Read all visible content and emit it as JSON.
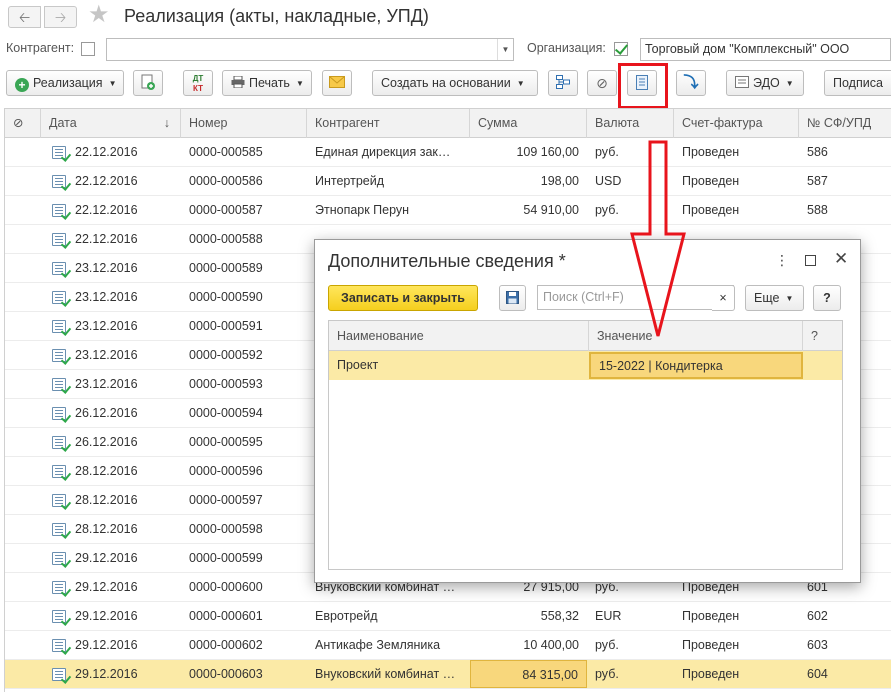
{
  "window": {
    "back_icon": "arrow-left-icon",
    "forward_icon": "arrow-right-icon",
    "star_icon": "star-icon",
    "title": "Реализация (акты, накладные, УПД)"
  },
  "filters": {
    "counterparty_label": "Контрагент:",
    "counterparty_value": "",
    "organization_label": "Организация:",
    "organization_value": "Торговый дом \"Комплексный\" ООО"
  },
  "toolbar": {
    "realization_label": "Реализация",
    "print_label": "Печать",
    "create_based_label": "Создать на основании",
    "edo_label": "ЭДО",
    "sign_label": "Подписа",
    "dtkt_label_top": "ДТ",
    "dtkt_label_bottom": "КТ"
  },
  "table": {
    "columns": [
      "Дата",
      "Номер",
      "Контрагент",
      "Сумма",
      "Валюта",
      "Счет-фактура",
      "№ СФ/УПД"
    ],
    "sort_indicator": "↓",
    "rows": [
      {
        "date": "22.12.2016",
        "number": "0000-000585",
        "counterparty": "Единая дирекция зак…",
        "sum": "109 160,00",
        "currency": "руб.",
        "invoice": "Проведен",
        "sf": "586"
      },
      {
        "date": "22.12.2016",
        "number": "0000-000586",
        "counterparty": "Интертрейд",
        "sum": "198,00",
        "currency": "USD",
        "invoice": "Проведен",
        "sf": "587"
      },
      {
        "date": "22.12.2016",
        "number": "0000-000587",
        "counterparty": "Этнопарк Перун",
        "sum": "54 910,00",
        "currency": "руб.",
        "invoice": "Проведен",
        "sf": "588"
      },
      {
        "date": "22.12.2016",
        "number": "0000-000588",
        "counterparty": "",
        "sum": "",
        "currency": "",
        "invoice": "",
        "sf": ""
      },
      {
        "date": "23.12.2016",
        "number": "0000-000589",
        "counterparty": "",
        "sum": "",
        "currency": "",
        "invoice": "",
        "sf": ""
      },
      {
        "date": "23.12.2016",
        "number": "0000-000590",
        "counterparty": "",
        "sum": "",
        "currency": "",
        "invoice": "",
        "sf": ""
      },
      {
        "date": "23.12.2016",
        "number": "0000-000591",
        "counterparty": "",
        "sum": "",
        "currency": "",
        "invoice": "",
        "sf": ""
      },
      {
        "date": "23.12.2016",
        "number": "0000-000592",
        "counterparty": "",
        "sum": "",
        "currency": "",
        "invoice": "",
        "sf": ""
      },
      {
        "date": "23.12.2016",
        "number": "0000-000593",
        "counterparty": "",
        "sum": "",
        "currency": "",
        "invoice": "",
        "sf": ""
      },
      {
        "date": "26.12.2016",
        "number": "0000-000594",
        "counterparty": "",
        "sum": "",
        "currency": "",
        "invoice": "",
        "sf": ""
      },
      {
        "date": "26.12.2016",
        "number": "0000-000595",
        "counterparty": "",
        "sum": "",
        "currency": "",
        "invoice": "",
        "sf": ""
      },
      {
        "date": "28.12.2016",
        "number": "0000-000596",
        "counterparty": "",
        "sum": "",
        "currency": "",
        "invoice": "",
        "sf": ""
      },
      {
        "date": "28.12.2016",
        "number": "0000-000597",
        "counterparty": "",
        "sum": "",
        "currency": "",
        "invoice": "",
        "sf": ""
      },
      {
        "date": "28.12.2016",
        "number": "0000-000598",
        "counterparty": "",
        "sum": "",
        "currency": "",
        "invoice": "",
        "sf": ""
      },
      {
        "date": "29.12.2016",
        "number": "0000-000599",
        "counterparty": "",
        "sum": "",
        "currency": "",
        "invoice": "",
        "sf": ""
      },
      {
        "date": "29.12.2016",
        "number": "0000-000600",
        "counterparty": "Внуковский комбинат …",
        "sum": "27 915,00",
        "currency": "руб.",
        "invoice": "Проведен",
        "sf": "601"
      },
      {
        "date": "29.12.2016",
        "number": "0000-000601",
        "counterparty": "Евротрейд",
        "sum": "558,32",
        "currency": "EUR",
        "invoice": "Проведен",
        "sf": "602"
      },
      {
        "date": "29.12.2016",
        "number": "0000-000602",
        "counterparty": "Антикафе Земляника",
        "sum": "10 400,00",
        "currency": "руб.",
        "invoice": "Проведен",
        "sf": "603"
      },
      {
        "date": "29.12.2016",
        "number": "0000-000603",
        "counterparty": "Внуковский комбинат …",
        "sum": "84 315,00",
        "currency": "руб.",
        "invoice": "Проведен",
        "sf": "604"
      }
    ]
  },
  "dialog": {
    "title": "Дополнительные сведения *",
    "menu_icon": "more-vertical-icon",
    "maximize_icon": "maximize-icon",
    "close_icon": "close-icon",
    "save_close_label": "Записать и закрыть",
    "search_placeholder": "Поиск (Ctrl+F)",
    "clear_label": "×",
    "more_label": "Еще",
    "help_label": "?",
    "columns": [
      "Наименование",
      "Значение",
      "?"
    ],
    "rows": [
      {
        "name": "Проект",
        "value": "15-2022 | Кондитерка",
        "flag": ""
      }
    ]
  }
}
